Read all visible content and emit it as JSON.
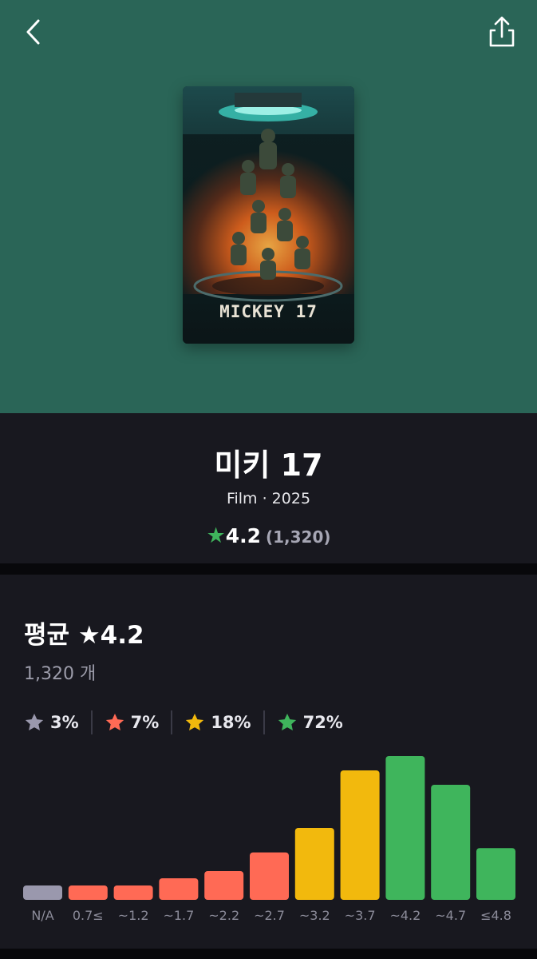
{
  "header": {
    "back_icon": "chevron-left-icon",
    "share_icon": "share-icon",
    "hero_color": "#2a6557"
  },
  "poster": {
    "title_text": "MICKEY 17"
  },
  "movie": {
    "title": "미키 17",
    "meta": "Film · 2025",
    "rating": "4.2",
    "rating_count": "(1,320)"
  },
  "stats": {
    "avg_label": "평균 ★4.2",
    "count_label": "1,320 개",
    "buckets": [
      {
        "label": "3%",
        "color": "#9a98ad"
      },
      {
        "label": "7%",
        "color": "#ff6a55"
      },
      {
        "label": "18%",
        "color": "#f2b90d"
      },
      {
        "label": "72%",
        "color": "#3fb55c"
      }
    ]
  },
  "chart_data": {
    "type": "bar",
    "categories": [
      "N/A",
      "0.7≤",
      "~1.2",
      "~1.7",
      "~2.2",
      "~2.7",
      "~3.2",
      "~3.7",
      "~4.2",
      "~4.7",
      "≤4.8"
    ],
    "values": [
      10,
      10,
      10,
      15,
      20,
      33,
      50,
      90,
      100,
      80,
      36
    ],
    "colors": [
      "#9a98ad",
      "#ff6a55",
      "#ff6a55",
      "#ff6a55",
      "#ff6a55",
      "#ff6a55",
      "#f2b90d",
      "#f2b90d",
      "#3fb55c",
      "#3fb55c",
      "#3fb55c"
    ],
    "ylim": [
      0,
      100
    ],
    "title": "",
    "xlabel": "",
    "ylabel": ""
  }
}
